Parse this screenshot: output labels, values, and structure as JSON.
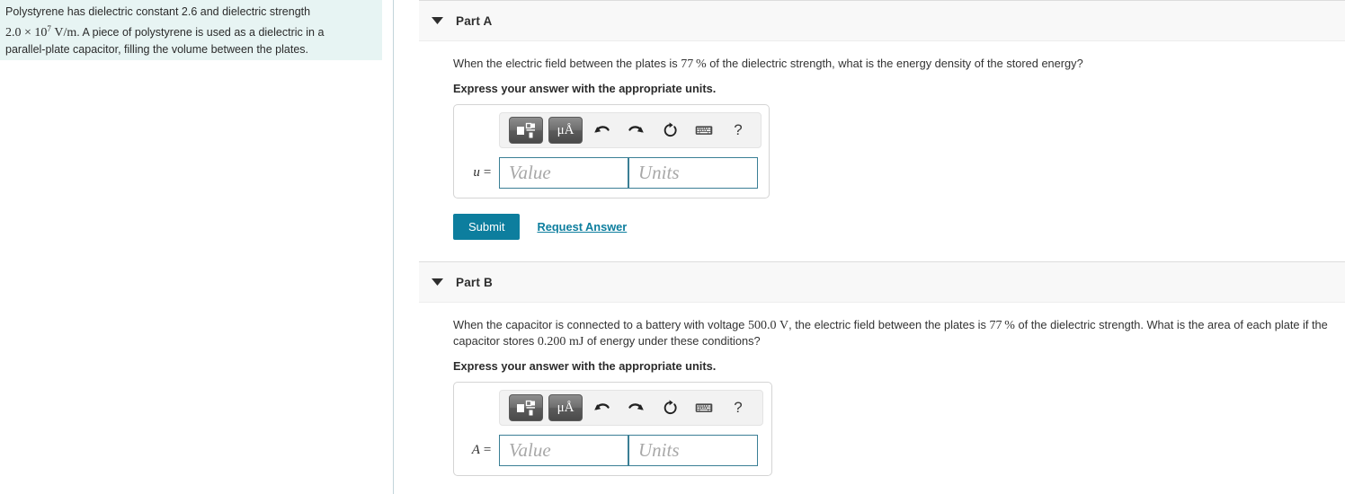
{
  "problem": {
    "line1_a": "Polystyrene has dielectric constant 2.6 and dielectric strength",
    "line2_num": "2.0",
    "line2_times": "×",
    "line2_base": "10",
    "line2_exp": "7",
    "line2_units": "V/m",
    "line2_b": ". A piece of polystyrene is used as a dielectric in a",
    "line3": "parallel-plate capacitor, filling the volume between the plates."
  },
  "parts": [
    {
      "id": "part-a",
      "title": "Part A",
      "question_pre": "When the electric field between the plates is ",
      "question_pct": "77 %",
      "question_post": " of the dielectric strength, what is the energy density of the stored energy?",
      "instruction": "Express your answer with the appropriate units.",
      "variable": "u =",
      "value_placeholder": "Value",
      "units_placeholder": "Units",
      "submit_label": "Submit",
      "request_answer_label": "Request Answer",
      "toolbar": {
        "template_icon": "math-template-icon",
        "units_label": "μÅ",
        "undo_icon": "undo-arrow-icon",
        "redo_icon": "redo-arrow-icon",
        "reset_icon": "reset-circular-arrow-icon",
        "keyboard_icon": "keyboard-icon",
        "help_label": "?"
      }
    },
    {
      "id": "part-b",
      "title": "Part B",
      "question_seg1": "When the capacitor is connected to a battery with voltage ",
      "question_voltage": "500.0",
      "question_voltage_unit": "V",
      "question_seg2": ", the electric field between the plates is ",
      "question_pct": "77 %",
      "question_seg3": " of the dielectric strength. What is the area of each plate if the capacitor stores ",
      "question_energy": "0.200",
      "question_energy_unit": "mJ",
      "question_seg4": " of energy under these conditions?",
      "instruction": "Express your answer with the appropriate units.",
      "variable": "A =",
      "value_placeholder": "Value",
      "units_placeholder": "Units",
      "toolbar": {
        "template_icon": "math-template-icon",
        "units_label": "μÅ",
        "undo_icon": "undo-arrow-icon",
        "redo_icon": "redo-arrow-icon",
        "reset_icon": "reset-circular-arrow-icon",
        "keyboard_icon": "keyboard-icon",
        "help_label": "?"
      }
    }
  ],
  "colors": {
    "accent": "#0d7e9e",
    "problem_panel_bg": "#e7f4f3",
    "header_bg": "#f8f8f8",
    "field_border": "#3b7f95"
  }
}
